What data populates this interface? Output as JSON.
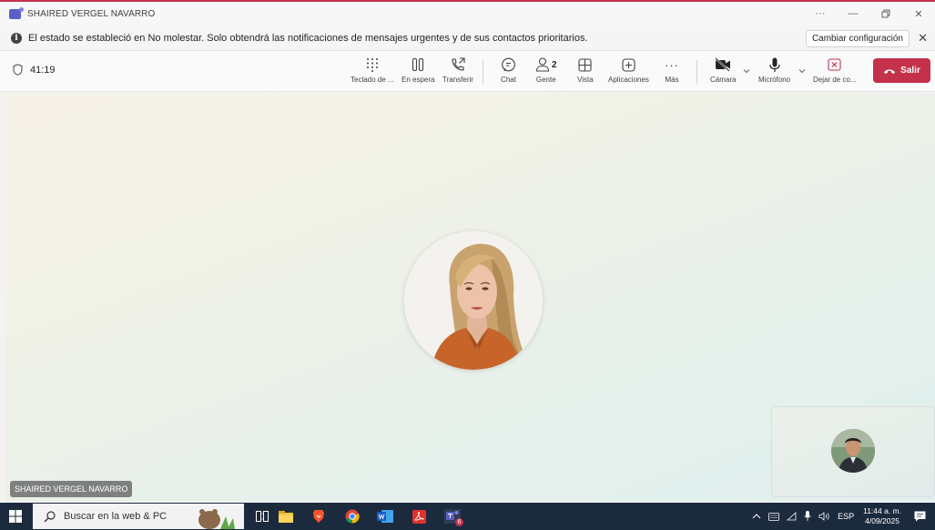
{
  "window": {
    "title": "SHAIRED VERGEL NAVARRO"
  },
  "notification": {
    "text": "El estado se estableció en No molestar. Solo obtendrá las notificaciones de mensajes urgentes y de sus contactos prioritarios.",
    "button_label": "Cambiar configuración"
  },
  "toolbar": {
    "timer": "41:19",
    "dialpad_label": "Teclado de ...",
    "hold_label": "En espera",
    "transfer_label": "Transferir",
    "chat_label": "Chat",
    "people_label": "Gente",
    "people_count": "2",
    "view_label": "Vista",
    "apps_label": "Aplicaciones",
    "more_label": "Más",
    "camera_label": "Cámara",
    "mic_label": "Micrófono",
    "stop_label": "Dejar de co...",
    "leave_label": "Salir"
  },
  "stage": {
    "participant_name": "SHAIRED VERGEL NAVARRO"
  },
  "taskbar": {
    "search_placeholder": "Buscar en la web & PC",
    "language": "ESP",
    "time": "11:44 a. m.",
    "date": "4/09/2025",
    "teams_badge": "6"
  },
  "colors": {
    "accent": "#5b5fc7",
    "leave": "#c4314b",
    "taskbar": "#1c2a3e"
  }
}
